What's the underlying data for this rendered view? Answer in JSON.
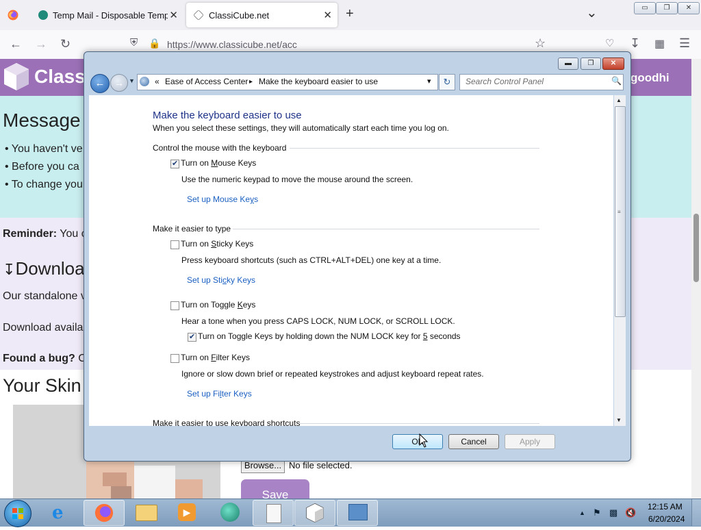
{
  "browser": {
    "tabs": [
      {
        "label": "Temp Mail - Disposable Tempo",
        "close": "✕"
      },
      {
        "label": "ClassiCube.net",
        "close": "✕"
      }
    ],
    "new_tab": "+",
    "list_all_tabs": "⌄",
    "url": "https://www.classicube.net/acc",
    "window_buttons": {
      "minimize": "▭",
      "restore": "❐",
      "close": "✕"
    }
  },
  "page": {
    "site_name": "Class",
    "user_name": "goodhi",
    "message_title": "Message",
    "bullets": [
      "You haven't ve",
      "Before you ca",
      "To change you"
    ],
    "reminder_label": "Reminder:",
    "reminder_text": "You c",
    "download_heading": "Downloa",
    "standalone_text": "Our standalone v",
    "download_avail": "Download availa",
    "bug_label": "Found a bug?",
    "bug_text": "C",
    "skin_heading": "Your Skin",
    "browse_button": "Browse...",
    "no_file": "No file selected.",
    "save_button": "Save"
  },
  "dialog": {
    "address": {
      "chevrons": "«",
      "crumb1": "Ease of Access Center",
      "sep": "▸",
      "crumb2": "Make the keyboard easier to use",
      "dropdown": "▾",
      "refresh": "↻"
    },
    "search_placeholder": "Search Control Panel",
    "title": "Make the keyboard easier to use",
    "subtitle": "When you select these settings, they will automatically start each time you log on.",
    "sections": [
      {
        "heading": "Control the mouse with the keyboard",
        "mouse_keys": {
          "checked": true,
          "label_pre": "Turn on ",
          "label_u": "M",
          "label_post": "ouse Keys",
          "desc": "Use the numeric keypad to move the mouse around the screen.",
          "link_pre": "Set up Mouse Ke",
          "link_u": "y",
          "link_post": "s"
        }
      },
      {
        "heading": "Make it easier to type",
        "sticky_keys": {
          "checked": false,
          "label_pre": "Turn on ",
          "label_u": "S",
          "label_post": "ticky Keys",
          "desc": "Press keyboard shortcuts (such as CTRL+ALT+DEL) one key at a time.",
          "link_pre": "Set up Sti",
          "link_u": "c",
          "link_post": "ky Keys"
        },
        "toggle_keys": {
          "checked": false,
          "label_pre": "Turn on Toggle ",
          "label_u": "K",
          "label_post": "eys",
          "desc": "Hear a tone when you press CAPS LOCK, NUM LOCK, or SCROLL LOCK.",
          "sub_checked": true,
          "sub_pre": "Turn on Toggle Keys by holding down the NUM LOCK key for ",
          "sub_u": "5",
          "sub_post": " seconds"
        },
        "filter_keys": {
          "checked": false,
          "label_pre": "Turn on ",
          "label_u": "F",
          "label_post": "ilter Keys",
          "desc": "Ignore or slow down brief or repeated keystrokes and adjust keyboard repeat rates.",
          "link_pre": "Set up Fi",
          "link_u": "l",
          "link_post": "ter Keys"
        }
      },
      {
        "heading": "Make it easier to use keyboard shortcuts"
      }
    ],
    "buttons": {
      "ok": "OK",
      "cancel": "Cancel",
      "apply": "Apply"
    }
  },
  "taskbar": {
    "time": "12:15 AM",
    "date": "6/20/2024",
    "items": [
      "ie-icon",
      "firefox-icon",
      "explorer-icon",
      "media-player-icon",
      "app-icon",
      "notepad-icon",
      "classicube-icon",
      "control-panel-icon"
    ]
  }
}
